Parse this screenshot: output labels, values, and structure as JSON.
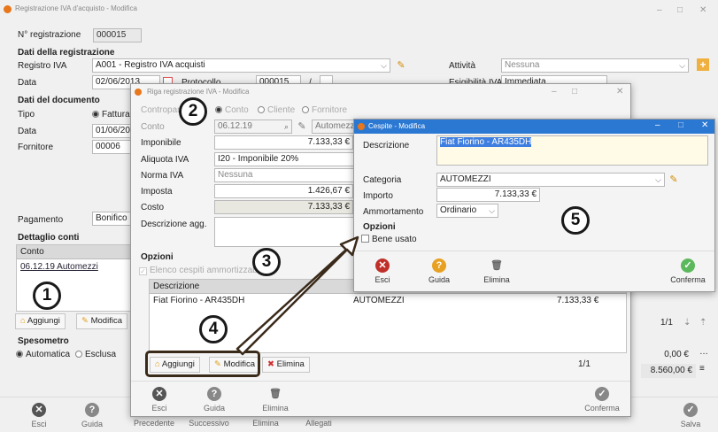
{
  "main": {
    "title": "Registrazione IVA d'acquisto - Modifica",
    "n_reg_label": "N° registrazione",
    "n_reg_value": "000015",
    "dati_reg": "Dati della registrazione",
    "registro_label": "Registro IVA",
    "registro_value": "A001 - Registro IVA acquisti",
    "attivita_label": "Attività",
    "attivita_value": "Nessuna",
    "data_label": "Data",
    "data_value": "02/06/2013",
    "protocollo_label": "Protocollo",
    "protocollo_value": "000015",
    "slash": "/",
    "esig_label": "Esigibilità IVA",
    "esig_value": "Immediata",
    "dati_doc": "Dati del documento",
    "tipo_label": "Tipo",
    "tipo_value": "Fattura",
    "data2_label": "Data",
    "data2_value": "01/06/201",
    "fornitore_label": "Fornitore",
    "fornitore_value": "00006",
    "pagamento_label": "Pagamento",
    "pagamento_value": "Bonifico b",
    "dettaglio": "Dettaglio conti",
    "conto_col": "Conto",
    "conto_row": "06.12.19 Automezzi",
    "aggiungi": "Aggiungi",
    "modifica": "Modifica",
    "spesometro": "Spesometro",
    "automatica": "Automatica",
    "esclusa": "Esclusa",
    "pager": "1/1",
    "tot1": "0,00 €",
    "tot2": "8.560,00 €",
    "toolbar": [
      "Esci",
      "Guida",
      "Precedente",
      "Successivo",
      "Elimina",
      "Allegati",
      "Salva"
    ]
  },
  "riga": {
    "title": "Riga registrazione IVA - Modifica",
    "contropartita_label": "Contropartita",
    "opt_conto": "Conto",
    "opt_cliente": "Cliente",
    "opt_fornitore": "Fornitore",
    "conto_label": "Conto",
    "conto_value": "06.12.19",
    "conto_desc": "Automezzi",
    "imponibile_label": "Imponibile",
    "imponibile_value": "7.133,33 €",
    "aliquota_label": "Aliquota IVA",
    "aliquota_value": "I20 - Imponibile 20%",
    "norma_label": "Norma IVA",
    "norma_value": "Nessuna",
    "imposta_label": "Imposta",
    "imposta_value": "1.426,67 €",
    "costo_label": "Costo",
    "costo_value": "7.133,33 €",
    "descr_label": "Descrizione agg.",
    "opzioni": "Opzioni",
    "elenco": "Elenco cespiti ammortizzabili",
    "col_descr": "Descrizione",
    "row_descr": "Fiat Fiorino - AR435DH",
    "row_cat": "AUTOMEZZI",
    "row_importo": "7.133,33 €",
    "aggiungi": "Aggiungi",
    "modifica": "Modifica",
    "elimina": "Elimina",
    "pager": "1/1",
    "toolbar": [
      "Esci",
      "Guida",
      "Elimina",
      "Conferma"
    ]
  },
  "cespite": {
    "title": "Cespite - Modifica",
    "descr_label": "Descrizione",
    "descr_value": "Fiat Fiorino - AR435DH",
    "categoria_label": "Categoria",
    "categoria_value": "AUTOMEZZI",
    "importo_label": "Importo",
    "importo_value": "7.133,33 €",
    "amm_label": "Ammortamento",
    "amm_value": "Ordinario",
    "opzioni": "Opzioni",
    "bene_usato": "Bene usato",
    "toolbar": [
      "Esci",
      "Guida",
      "Elimina",
      "Conferma"
    ]
  },
  "badges": [
    "1",
    "2",
    "3",
    "4",
    "5"
  ],
  "colors": {
    "titlebar_blue": "#2b78d3",
    "accent_orange": "#e8a020",
    "annot_box": "#3a2a1a"
  }
}
